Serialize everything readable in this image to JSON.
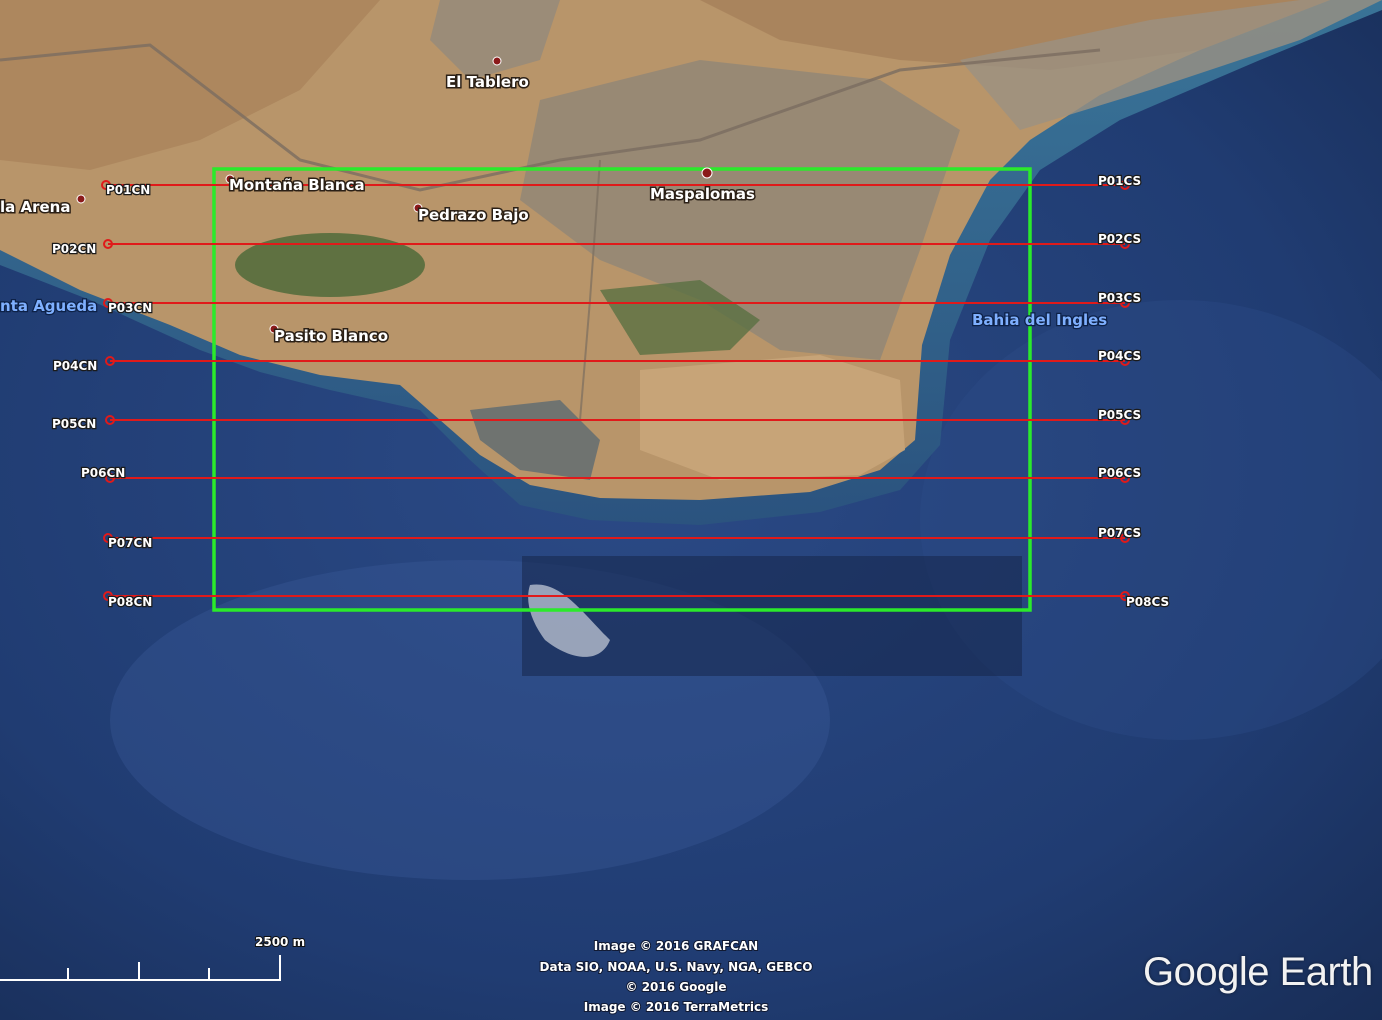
{
  "places": [
    {
      "id": "el-tablero",
      "label": "El Tablero"
    },
    {
      "id": "montana-blanca",
      "label": "Montaña Blanca"
    },
    {
      "id": "maspalomas",
      "label": "Maspalomas"
    },
    {
      "id": "pedrazo-bajo",
      "label": "Pedrazo Bajo"
    },
    {
      "id": "la-arena",
      "label": "la Arena"
    },
    {
      "id": "santa-agueda",
      "label": "nta Agueda"
    },
    {
      "id": "pasito-blanco",
      "label": "Pasito Blanco"
    },
    {
      "id": "bahia-del-ingles",
      "label": "Bahia del Ingles"
    }
  ],
  "profiles": [
    {
      "west": "P01CN",
      "east": "P01CS"
    },
    {
      "west": "P02CN",
      "east": "P02CS"
    },
    {
      "west": "P03CN",
      "east": "P03CS"
    },
    {
      "west": "P04CN",
      "east": "P04CS"
    },
    {
      "west": "P05CN",
      "east": "P05CS"
    },
    {
      "west": "P06CN",
      "east": "P06CS"
    },
    {
      "west": "P07CN",
      "east": "P07CS"
    },
    {
      "west": "P08CN",
      "east": "P08CS"
    }
  ],
  "scale": {
    "label": "2500 m"
  },
  "credits": [
    "Image © 2016 GRAFCAN",
    "Data SIO, NOAA, U.S. Navy, NGA, GEBCO",
    "© 2016 Google",
    "Image © 2016 TerraMetrics"
  ],
  "brand": "Google Earth",
  "colors": {
    "profile_line": "#e01a1a",
    "study_area": "#2bea2b",
    "land": "#b8956a",
    "sea": "#1d3564"
  }
}
